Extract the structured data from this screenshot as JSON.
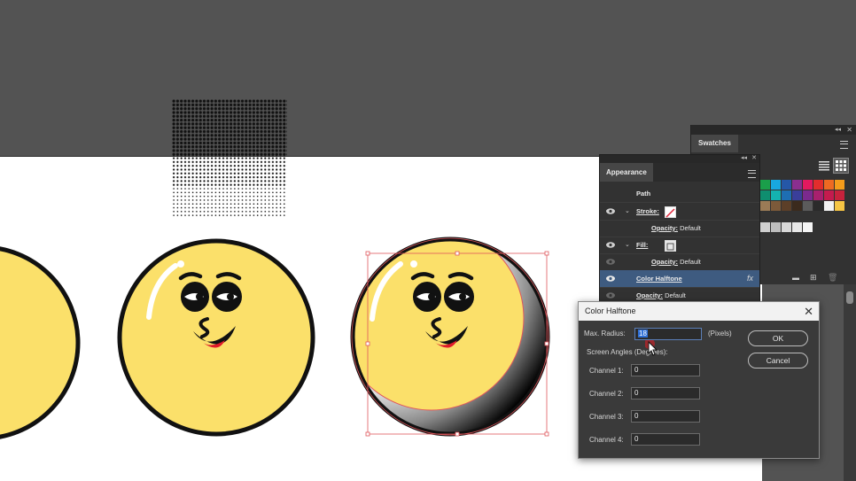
{
  "swatches": {
    "tab": "Swatches",
    "rows": [
      [
        "#1a9f4a",
        "#18a7df",
        "#2557a7",
        "#8a2f8f",
        "#e3195f",
        "#e22d2d",
        "#ee6a22",
        "#f49c1b"
      ],
      [
        "#0f8e6f",
        "#14b3b0",
        "#1e6eb3",
        "#3a3f9a",
        "#7b2a8e",
        "#a8206e",
        "#c41b4e",
        "#c7223c"
      ],
      [
        "#9a7b56",
        "#7c5a3a",
        "#5c3f28",
        "#3b2a1d",
        "#5b5b5b",
        "#2b2b2b",
        "#f2f2f2",
        "#f6c544"
      ],
      [],
      [
        "#cfcfcf",
        "#bdbdbd",
        "#d9d9d9",
        "#e8e8e8",
        "#f4f4f4"
      ]
    ]
  },
  "appearance": {
    "tab": "Appearance",
    "path_label": "Path",
    "stroke_label": "Stroke:",
    "fill_label": "Fill:",
    "opacity_label": "Opacity:",
    "opacity_value": "Default",
    "effect_label": "Color Halftone",
    "fx": "fx"
  },
  "dialog": {
    "title": "Color Halftone",
    "max_radius_label": "Max. Radius:",
    "max_radius_value": "18",
    "unit": "(Pixels)",
    "screen_angles_label": "Screen Angles (Degrees):",
    "channels": [
      {
        "label": "Channel 1:",
        "value": "0"
      },
      {
        "label": "Channel 2:",
        "value": "0"
      },
      {
        "label": "Channel 3:",
        "value": "0"
      },
      {
        "label": "Channel 4:",
        "value": "0"
      }
    ],
    "ok_label": "OK",
    "cancel_label": "Cancel",
    "close_glyph": "✕"
  },
  "colors": {
    "face_yellow": "#fbe06a",
    "selection": "#e0575c",
    "dialog_bg": "#3a3a3a",
    "panel_bg": "#323232",
    "selected_row": "#3e5b80"
  },
  "icons": [
    "eye-icon",
    "chevron-down-icon",
    "stroke-swatch-icon",
    "fill-swatch-icon",
    "fx-icon",
    "close-icon",
    "panel-menu-icon",
    "collapse-icon",
    "cursor-icon"
  ]
}
